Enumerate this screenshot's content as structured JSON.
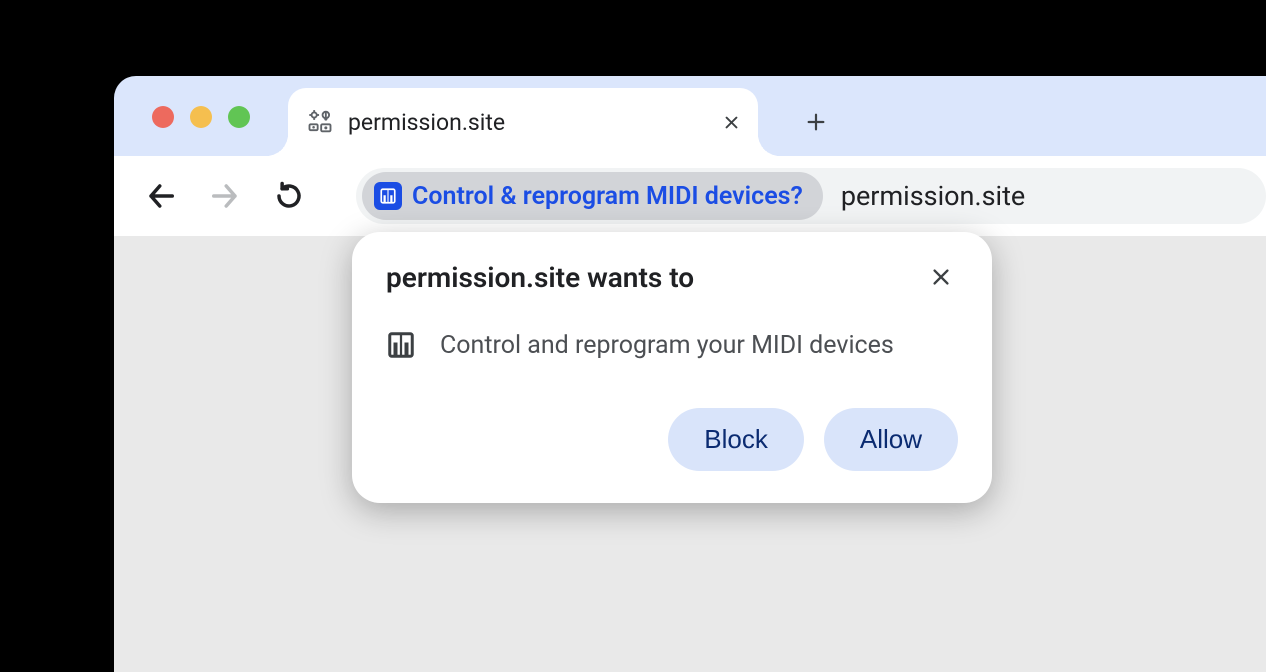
{
  "tab": {
    "title": "permission.site"
  },
  "addressBar": {
    "chipText": "Control & reprogram MIDI devices?",
    "url": "permission.site"
  },
  "popup": {
    "title": "permission.site wants to",
    "description": "Control and reprogram your MIDI devices",
    "blockLabel": "Block",
    "allowLabel": "Allow"
  }
}
